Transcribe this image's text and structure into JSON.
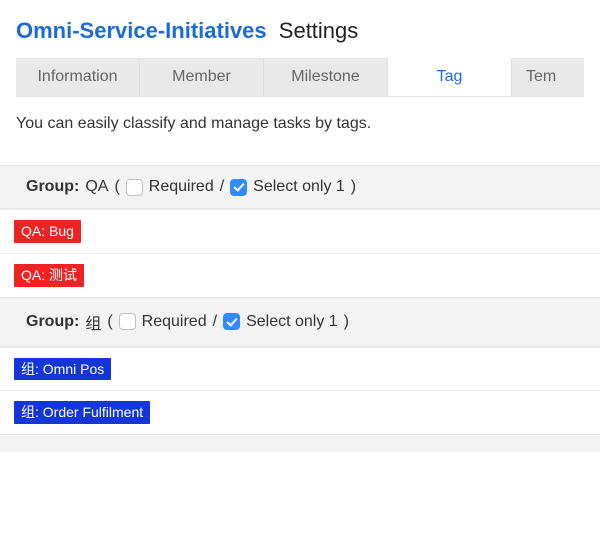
{
  "header": {
    "project_name": "Omni-Service-Initiatives",
    "page_title": "Settings"
  },
  "tabs": {
    "items": [
      {
        "label": "Information",
        "active": false
      },
      {
        "label": "Member",
        "active": false
      },
      {
        "label": "Milestone",
        "active": false
      },
      {
        "label": "Tag",
        "active": true
      },
      {
        "label": "Tem",
        "active": false
      }
    ]
  },
  "description": "You can easily classify and manage tasks by tags.",
  "labels": {
    "group_prefix": "Group:",
    "required": "Required",
    "separator": "/",
    "select_only_1": "Select only 1",
    "open_paren": "(",
    "close_paren": ")"
  },
  "groups": [
    {
      "name": "QA",
      "required_checked": false,
      "select_only_one_checked": true,
      "tags": [
        {
          "label": "QA: Bug",
          "color": "red"
        },
        {
          "label": "QA: 测试",
          "color": "red"
        }
      ]
    },
    {
      "name": "组",
      "required_checked": false,
      "select_only_one_checked": true,
      "tags": [
        {
          "label": "组: Omni Pos",
          "color": "blue"
        },
        {
          "label": "组: Order Fulfilment",
          "color": "blue"
        }
      ]
    }
  ]
}
